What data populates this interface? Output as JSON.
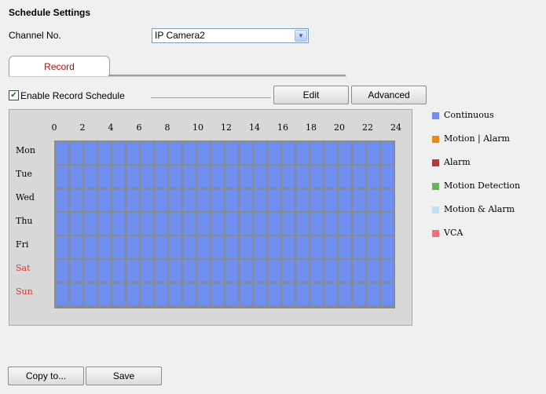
{
  "page": {
    "title": "Schedule Settings"
  },
  "channel": {
    "label": "Channel No.",
    "value": "IP Camera2"
  },
  "tabs": [
    {
      "label": "Record"
    }
  ],
  "enable_schedule": {
    "label": "Enable Record Schedule",
    "checked": true
  },
  "buttons": {
    "edit": "Edit",
    "advanced": "Advanced",
    "copy": "Copy to...",
    "save": "Save"
  },
  "schedule": {
    "hours": [
      "0",
      "2",
      "4",
      "6",
      "8",
      "10",
      "12",
      "14",
      "16",
      "18",
      "20",
      "22",
      "24"
    ],
    "days": [
      "Mon",
      "Tue",
      "Wed",
      "Thu",
      "Fri",
      "Sat",
      "Sun"
    ],
    "weekend_color": "#e03030",
    "fill_type": "Continuous"
  },
  "legend": [
    {
      "label": "Continuous",
      "color": "#6e8ff0"
    },
    {
      "label": "Motion | Alarm",
      "color": "#e8891a"
    },
    {
      "label": "Alarm",
      "color": "#b33a3a"
    },
    {
      "label": "Motion Detection",
      "color": "#6db35d"
    },
    {
      "label": "Motion & Alarm",
      "color": "#bfe0f5"
    },
    {
      "label": "VCA",
      "color": "#ef6f7a"
    }
  ]
}
